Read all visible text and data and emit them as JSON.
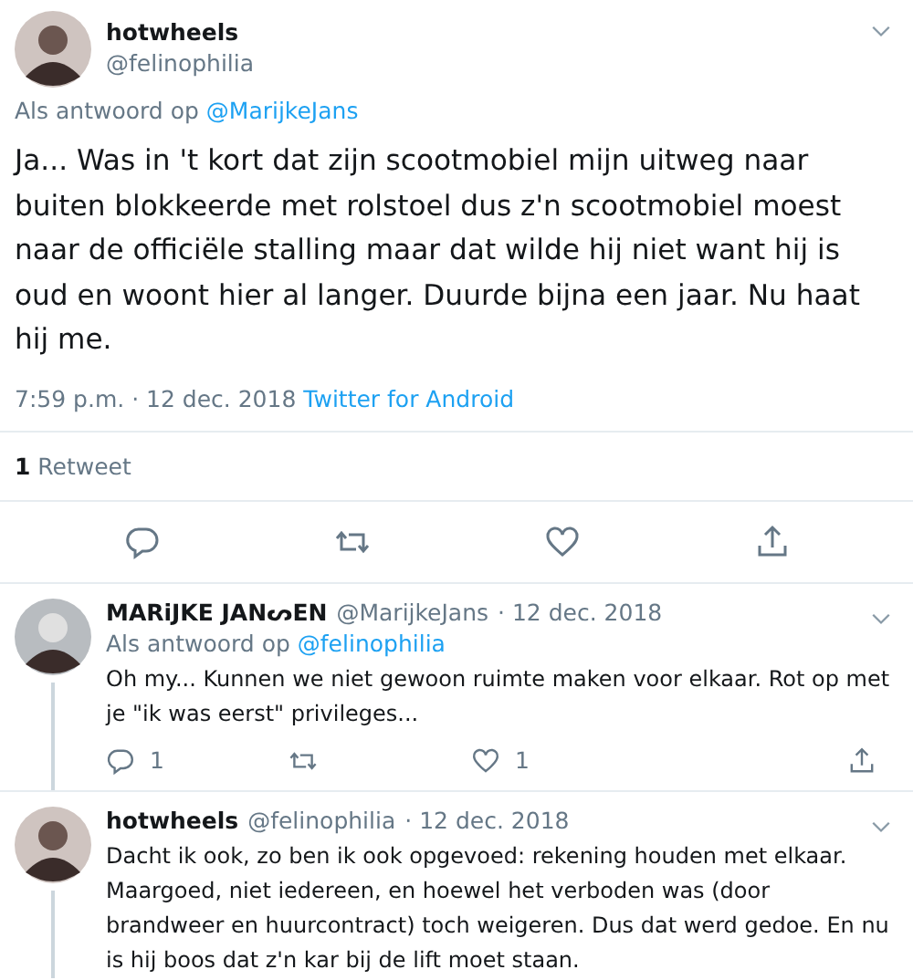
{
  "main_tweet": {
    "name": "hotwheels",
    "handle": "@felinophilia",
    "reply_to_label": "Als antwoord op",
    "reply_to": "@MarijkeJans",
    "text": "Ja... Was in 't kort dat zijn scootmobiel mijn uitweg naar buiten blokkeerde met rolstoel dus z'n scootmobiel moest naar de officiële stalling maar dat wilde hij niet want hij is oud en woont hier al langer. Duurde bijna een jaar. Nu haat hij me.",
    "time": "7:59 p.m. · 12 dec. 2018",
    "source": "Twitter for Android",
    "retweets_count": "1",
    "retweets_label": "Retweet"
  },
  "replies": [
    {
      "name": "MARiJKE JANᔕEN",
      "handle": "@MarijkeJans",
      "date": "· 12 dec. 2018",
      "reply_to_label": "Als antwoord op",
      "reply_to": "@felinophilia",
      "text": "Oh my... Kunnen we niet gewoon ruimte maken voor elkaar. Rot op met je \"ik was eerst\" privileges...",
      "reply_count": "1",
      "like_count": "1"
    },
    {
      "name": "hotwheels",
      "handle": "@felinophilia",
      "date": "· 12 dec. 2018",
      "text": "Dacht ik ook, zo ben ik ook opgevoed: rekening houden met elkaar. Maargoed, niet iedereen, en hoewel het verboden was (door brandweer en huurcontract) toch weigeren. Dus dat werd gedoe. En nu is hij boos dat z'n kar bij de lift moet staan."
    }
  ]
}
